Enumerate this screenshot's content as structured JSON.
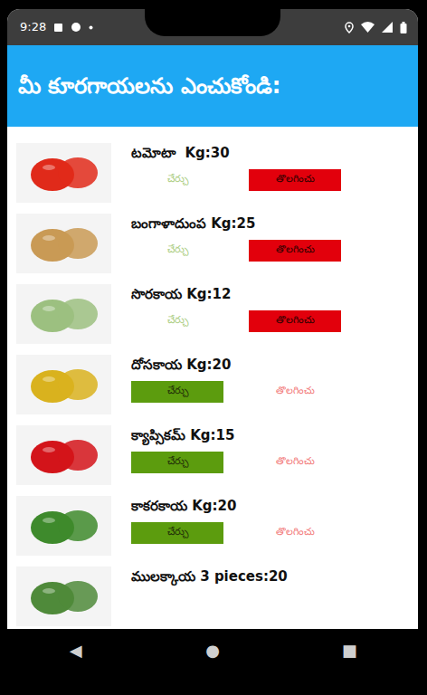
{
  "status_bar": {
    "time": "9:28"
  },
  "header": {
    "title": "మీ కూరగాయలను ఎంచుకోండి:"
  },
  "items": [
    {
      "label": "టమోటా  Kg:30",
      "color": "#e02a1a",
      "add": {
        "label": "చేర్చు",
        "disabled": true
      },
      "remove": {
        "label": "తొలగించు",
        "disabled": false
      }
    },
    {
      "label": "బంగాళాదుంప Kg:25",
      "color": "#c99a55",
      "add": {
        "label": "చేర్చు",
        "disabled": true
      },
      "remove": {
        "label": "తొలగించు",
        "disabled": false
      }
    },
    {
      "label": "సొరకాయ Kg:12",
      "color": "#9cc080",
      "add": {
        "label": "చేర్చు",
        "disabled": true
      },
      "remove": {
        "label": "తొలగించు",
        "disabled": false
      }
    },
    {
      "label": "దోసకాయ Kg:20",
      "color": "#d9b21e",
      "add": {
        "label": "చేర్చు",
        "disabled": false
      },
      "remove": {
        "label": "తొలగించు",
        "disabled": true
      }
    },
    {
      "label": "క్యాప్సికమ్ Kg:15",
      "color": "#d3141a",
      "add": {
        "label": "చేర్చు",
        "disabled": false
      },
      "remove": {
        "label": "తొలగించు",
        "disabled": true
      }
    },
    {
      "label": "కాకరకాయ Kg:20",
      "color": "#3e8a2c",
      "add": {
        "label": "చేర్చు",
        "disabled": false
      },
      "remove": {
        "label": "తొలగించు",
        "disabled": true
      }
    },
    {
      "label": "ములక్కాయ 3 pieces:20",
      "color": "#4f8a3a"
    }
  ],
  "nav": [
    "◀",
    "●",
    "■"
  ]
}
